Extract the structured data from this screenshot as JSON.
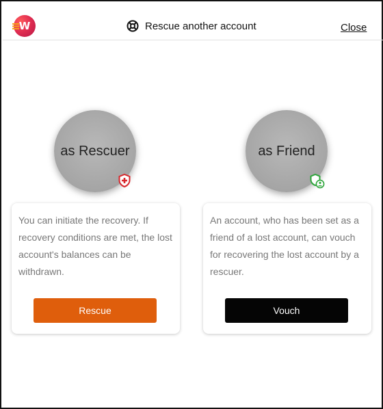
{
  "header": {
    "logo_letter": "W",
    "logo_icon": "app-logo",
    "title_icon": "lifebuoy-icon",
    "title": "Rescue another account",
    "close_label": "Close"
  },
  "roles": [
    {
      "label": "as Rescuer",
      "badge_icon": "shield-plus-icon",
      "badge_color": "#d8262b",
      "description": "You can initiate the recovery. If recovery conditions are met, the lost account's balances can be withdrawn.",
      "button_label": "Rescue",
      "button_color": "#df5e0c"
    },
    {
      "label": "as Friend",
      "badge_icon": "shield-user-icon",
      "badge_color": "#2ea63b",
      "description": "An account, who has been set as a friend of a lost account, can vouch for recovering the lost account by a rescuer.",
      "button_label": "Vouch",
      "button_color": "#050505"
    }
  ]
}
